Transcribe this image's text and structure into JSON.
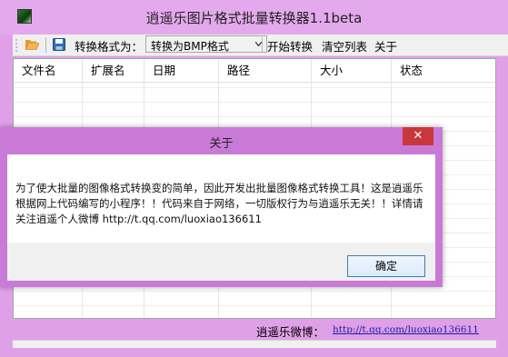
{
  "window": {
    "title": "逍遥乐图片格式批量转换器1.1beta"
  },
  "toolbar": {
    "convert_format_label": "转换格式为：",
    "format_select_value": "转换为BMP格式",
    "start_label": "开始转换",
    "clear_label": "清空列表",
    "about_label": "关于"
  },
  "list": {
    "columns": [
      "文件名",
      "扩展名",
      "日期",
      "路径",
      "大小",
      "状态"
    ]
  },
  "status": {
    "weibo_label": "逍遥乐微博：",
    "weibo_link": "http://t.qq.com/luoxiao136611"
  },
  "dialog": {
    "title": "关于",
    "close_glyph": "✕",
    "message": "为了使大批量的图像格式转换变的简单，因此开发出批量图像格式转换工具！这是逍遥乐根据网上代码编写的小程序！！代码来自于网络，一切版权行为与逍遥乐无关！！详情请关注逍遥个人微博 http://t.qq.com/luoxiao136611",
    "ok_label": "确定"
  },
  "icons": {
    "app": "app-icon",
    "open": "folder-icon",
    "save": "save-icon",
    "dropdown": "chevron-down-icon",
    "close": "close-icon"
  },
  "colors": {
    "desktop": "#d94fd9",
    "window_frame": "#e4a9ec",
    "dialog_frame": "#c97ad7",
    "close_button": "#c8373b",
    "link": "#1a1aa6"
  }
}
